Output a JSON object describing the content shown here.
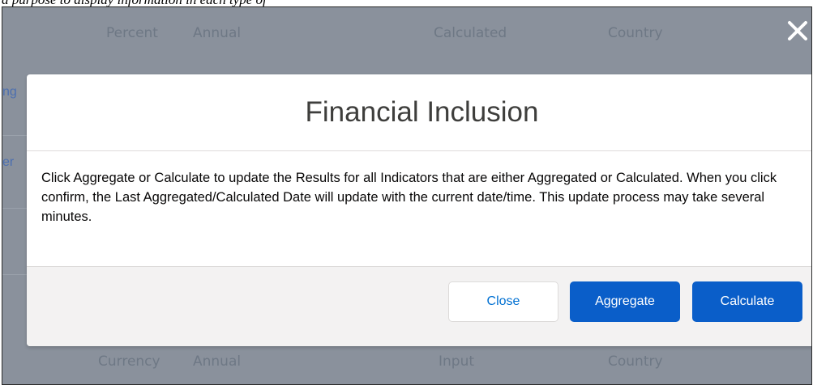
{
  "caption": {
    "text": "a purpose to display information in each type of"
  },
  "background": {
    "top_headers": [
      "Percent",
      "Annual",
      "Calculated",
      "Country"
    ],
    "bottom_row": [
      "Currency",
      "Annual",
      "Input",
      "Country"
    ],
    "left_fragments": [
      "ng",
      "er"
    ]
  },
  "modal": {
    "title": "Financial Inclusion",
    "body": "Click Aggregate or Calculate to update the Results for all Indicators that are either Aggregated or Calculated. When you click confirm, the Last Aggregated/Calculated Date will update with the current date/time. This update process may take several minutes.",
    "buttons": {
      "close": "Close",
      "aggregate": "Aggregate",
      "calculate": "Calculate"
    }
  },
  "colors": {
    "brand": "#0a5ec9",
    "neutral_text": "#0070d2",
    "overlay": "#8a919c"
  }
}
